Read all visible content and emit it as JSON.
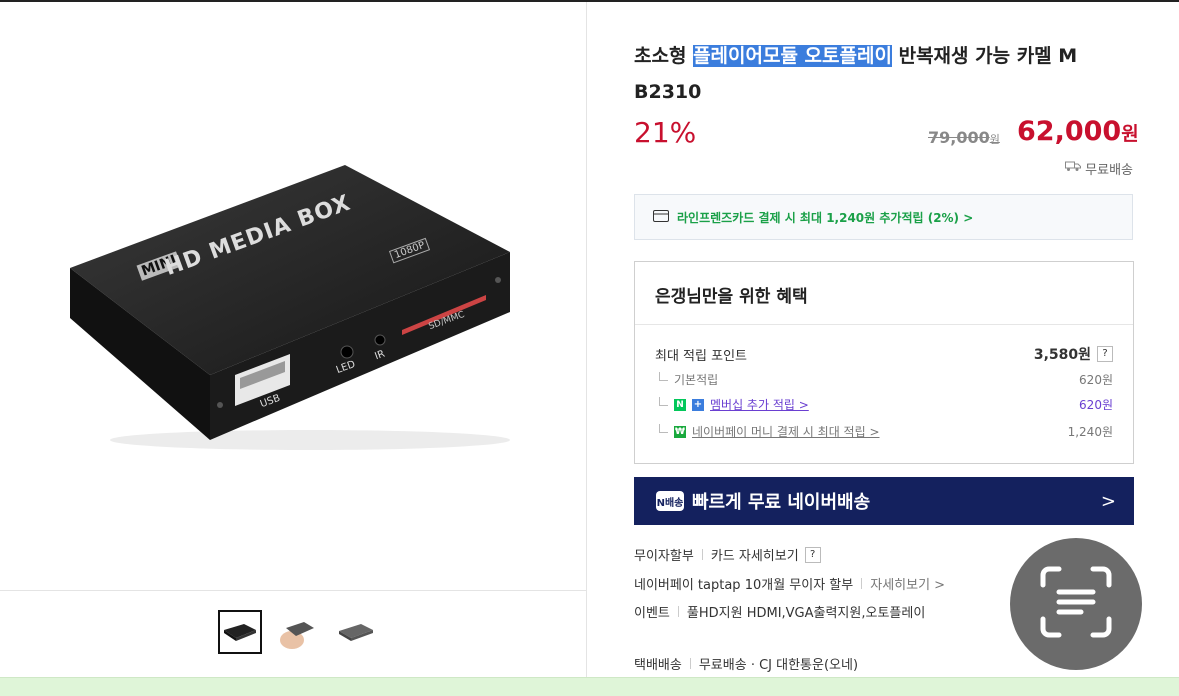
{
  "product": {
    "title_pre": "초소형 ",
    "title_highlight": "플레이어모듈 오토플레이",
    "title_post": " 반복재생 가능 카멜 M B2310",
    "discount": "21%",
    "old_price": "79,000",
    "old_price_unit": "원",
    "price": "62,000",
    "price_unit": "원",
    "shipping_tag": "무료배송"
  },
  "image_text": {
    "brand_mini": "MINI",
    "brand_main": "HD MEDIA BOX",
    "res_badge": "1080P",
    "sd_label": "SD/MMC",
    "led": "LED",
    "ir": "IR",
    "usb": "USB"
  },
  "card_promo": {
    "text": "라인프렌즈카드 결제 시 최대 1,240원 추가적립 (2%) >"
  },
  "benefits": {
    "title": "은갱님만을 위한 혜택",
    "max_points_label": "최대 적립 포인트",
    "max_points_value": "3,580원",
    "rows": [
      {
        "label": "기본적립",
        "value": "620원"
      },
      {
        "label": "멤버십 추가 적립 >",
        "value": "620원"
      },
      {
        "label": "네이버페이 머니 결제 시 최대 적립 >",
        "value": "1,240원"
      }
    ]
  },
  "delivery_banner": {
    "badge": "N배송",
    "text": "빠르게 무료 네이버배송",
    "chevron": ">"
  },
  "info": {
    "installment_label": "무이자할부",
    "card_detail": "카드 자세히보기",
    "naverpay_text": "네이버페이 taptap 10개월 무이자 할부",
    "detail_link": "자세히보기 >",
    "event_label": "이벤트",
    "event_text": "풀HD지원 HDMI,VGA출력지원,오토플레이",
    "ship_label": "택배배송",
    "ship_text": "무료배송 · CJ 대한통운(오네)"
  },
  "colors": {
    "accent_red": "#c8102e",
    "naver_green": "#03c75a",
    "navy": "#14215e",
    "highlight_blue": "#3b7ddd"
  },
  "icons": [
    "truck-icon",
    "card-icon",
    "question-icon",
    "npay-icon",
    "plus-icon",
    "scan-text-icon"
  ]
}
